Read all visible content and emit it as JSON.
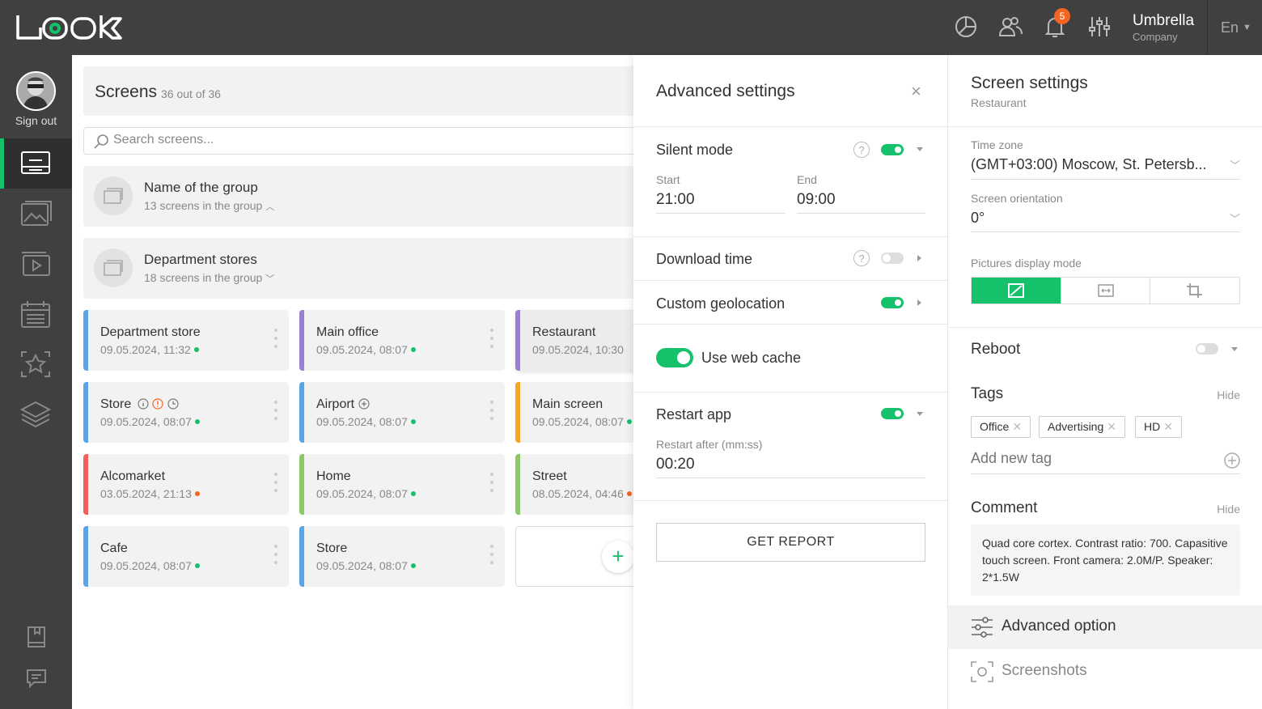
{
  "brand": {
    "logo": "LOOK",
    "accent": "#15c26b"
  },
  "header": {
    "notifications_count": "5",
    "user_name": "Umbrella",
    "user_role": "Company",
    "language": "En",
    "icons": [
      "analytics-icon",
      "users-icon",
      "bell-icon",
      "sliders-icon"
    ]
  },
  "sidebar": {
    "sign_out": "Sign out",
    "items": [
      {
        "icon": "screens-icon",
        "active": true
      },
      {
        "icon": "images-icon"
      },
      {
        "icon": "playlist-icon"
      },
      {
        "icon": "schedule-icon"
      },
      {
        "icon": "favorites-icon"
      },
      {
        "icon": "layers-icon"
      },
      {
        "icon": "book-icon"
      },
      {
        "icon": "chat-icon"
      }
    ]
  },
  "screens": {
    "title": "Screens",
    "count": "36 out of 36",
    "search_placeholder": "Search screens...",
    "groups": [
      {
        "name": "Name of the group",
        "sub": "13 screens in the group",
        "expanded": true
      },
      {
        "name": "Department stores",
        "sub": "18 screens in the group",
        "expanded": false
      }
    ],
    "cards": [
      {
        "name": "Department store",
        "date": "09.05.2024, 11:32",
        "color": "#5aa5e8",
        "status": "#15c26b"
      },
      {
        "name": "Main office",
        "date": "09.05.2024, 08:07",
        "color": "#9b7fd4",
        "status": "#15c26b"
      },
      {
        "name": "Restaurant",
        "date": "09.05.2024, 10:30",
        "color": "#9b7fd4",
        "status": ""
      },
      {
        "name": "Store",
        "date": "09.05.2024, 08:07",
        "color": "#5aa5e8",
        "status": "#15c26b"
      },
      {
        "name": "Airport",
        "date": "09.05.2024, 08:07",
        "color": "#5aa5e8",
        "status": "#15c26b"
      },
      {
        "name": "Main screen",
        "date": "09.05.2024, 08:07",
        "color": "#f5a623",
        "status": "#15c26b"
      },
      {
        "name": "Alcomarket",
        "date": "03.05.2024, 21:13",
        "color": "#f0605a",
        "status": "#f26522"
      },
      {
        "name": "Home",
        "date": "09.05.2024, 08:07",
        "color": "#8dc96b",
        "status": "#15c26b"
      },
      {
        "name": "Street",
        "date": "08.05.2024, 04:46",
        "color": "#8dc96b",
        "status": "#f26522"
      },
      {
        "name": "Cafe",
        "date": "09.05.2024, 08:07",
        "color": "#5aa5e8",
        "status": "#15c26b"
      },
      {
        "name": "Store",
        "date": "09.05.2024, 08:07",
        "color": "#5aa5e8",
        "status": "#15c26b"
      }
    ]
  },
  "advanced": {
    "title": "Advanced settings",
    "silent_mode": {
      "label": "Silent mode",
      "on": true,
      "start_label": "Start",
      "start": "21:00",
      "end_label": "End",
      "end": "09:00"
    },
    "download_time": {
      "label": "Download time",
      "on": false
    },
    "custom_geolocation": {
      "label": "Custom geolocation",
      "on": true
    },
    "web_cache": {
      "label": "Use web cache",
      "on": true
    },
    "restart_app": {
      "label": "Restart app",
      "on": true,
      "after_label": "Restart after (mm:ss)",
      "after": "00:20"
    },
    "report_button": "GET REPORT"
  },
  "settings": {
    "title": "Screen settings",
    "subtitle": "Restaurant",
    "timezone_label": "Time zone",
    "timezone": "(GMT+03:00) Moscow, St. Petersb...",
    "orientation_label": "Screen orientation",
    "orientation": "0°",
    "display_mode_label": "Pictures display mode",
    "reboot": {
      "label": "Reboot",
      "on": false
    },
    "tags_label": "Tags",
    "tags_hide": "Hide",
    "tags": [
      "Office",
      "Advertising",
      "HD"
    ],
    "add_tag_placeholder": "Add new tag",
    "comment_label": "Comment",
    "comment_hide": "Hide",
    "comment": "Quad core cortex. Contrast ratio: 700. Capasitive touch screen. Front camera: 2.0M/P. Speaker: 2*1.5W",
    "options": [
      {
        "label": "Advanced option",
        "active": true
      },
      {
        "label": "Screenshots",
        "active": false
      }
    ]
  }
}
